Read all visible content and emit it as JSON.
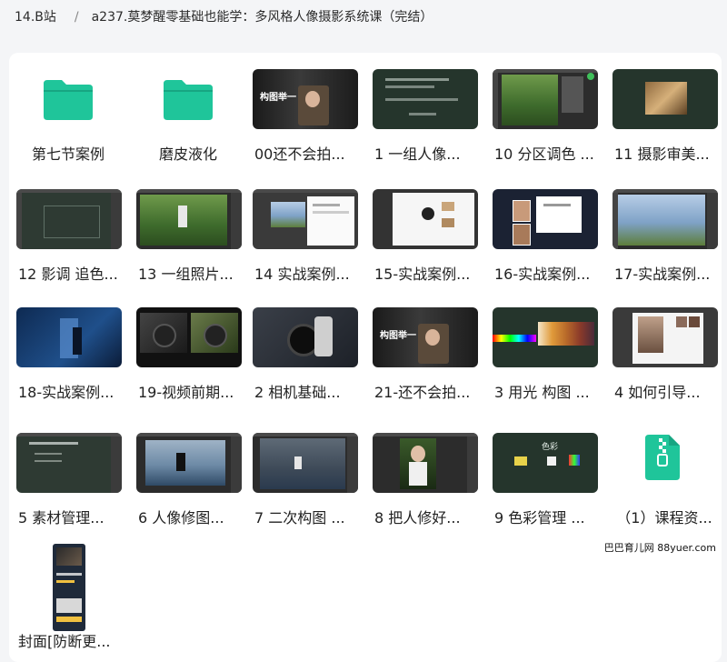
{
  "breadcrumb": {
    "parent": "14.B站",
    "separator": "/",
    "current": "a237.莫梦醒零基础也能学：多风格人像摄影系统课（完结）"
  },
  "colors": {
    "folder": "#1fc59a",
    "zip": "#1fc59a",
    "thumb_green": "#25352c"
  },
  "items": [
    {
      "label": "第七节案例",
      "type": "folder",
      "icon": "folder-icon"
    },
    {
      "label": "磨皮液化",
      "type": "folder",
      "icon": "folder-icon"
    },
    {
      "label": "00还不会拍...",
      "type": "video",
      "overlay": "构图举一"
    },
    {
      "label": "1 一组人像...",
      "type": "video"
    },
    {
      "label": "10 分区调色 ...",
      "type": "video"
    },
    {
      "label": "11 摄影审美...",
      "type": "video"
    },
    {
      "label": "12 影调 追色...",
      "type": "video"
    },
    {
      "label": "13 一组照片...",
      "type": "video"
    },
    {
      "label": "14 实战案例...",
      "type": "video"
    },
    {
      "label": "15-实战案例...",
      "type": "video"
    },
    {
      "label": "16-实战案例...",
      "type": "video"
    },
    {
      "label": "17-实战案例...",
      "type": "video"
    },
    {
      "label": "18-实战案例...",
      "type": "video"
    },
    {
      "label": "19-视频前期...",
      "type": "video"
    },
    {
      "label": "2 相机基础...",
      "type": "video"
    },
    {
      "label": "21-还不会拍...",
      "type": "video",
      "overlay": "构图举一"
    },
    {
      "label": "3 用光 构图 ...",
      "type": "video"
    },
    {
      "label": "4 如何引导...",
      "type": "video"
    },
    {
      "label": "5 素材管理...",
      "type": "video"
    },
    {
      "label": "6 人像修图...",
      "type": "video"
    },
    {
      "label": "7 二次构图 ...",
      "type": "video"
    },
    {
      "label": "8 把人修好...",
      "type": "video"
    },
    {
      "label": "9 色彩管理 ...",
      "type": "video",
      "overlay": "色彩"
    },
    {
      "label": "（1）课程资...",
      "type": "zip",
      "icon": "zip-file-icon"
    },
    {
      "label": "封面[防断更...",
      "type": "image"
    }
  ],
  "watermark": "巴巴育儿网 88yuer.com"
}
